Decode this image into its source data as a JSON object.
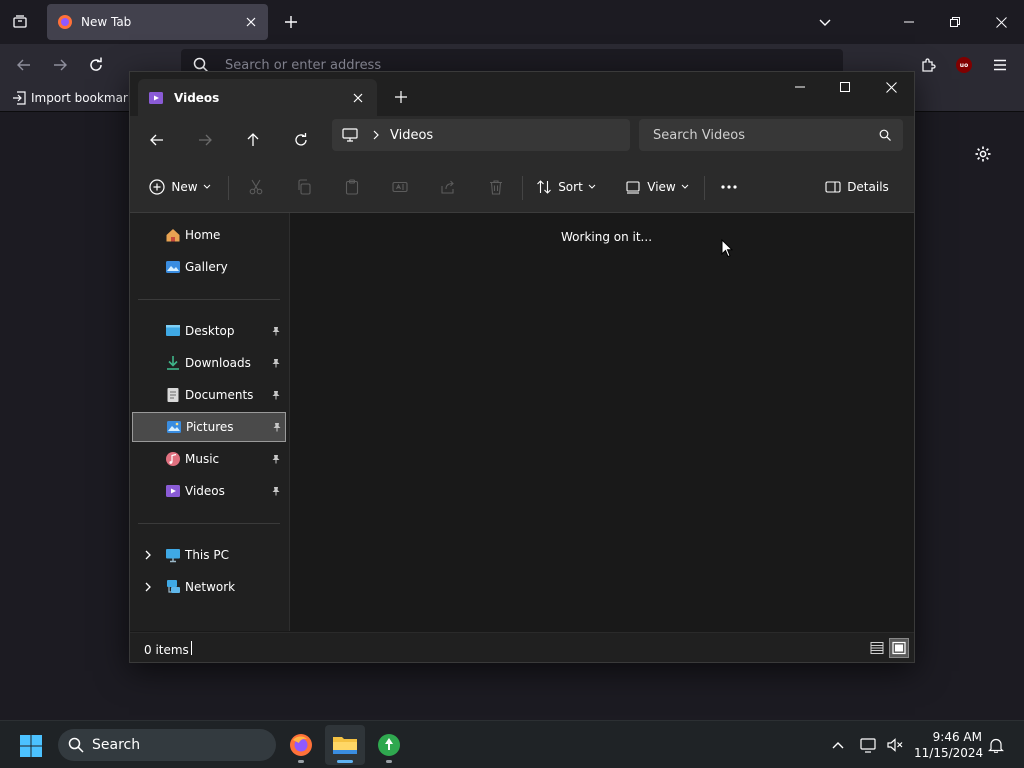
{
  "browser": {
    "tab_title": "New Tab",
    "address_placeholder": "Search or enter address",
    "import_bookmarks_label": "Import bookmarks",
    "extension_badge": "uo"
  },
  "explorer": {
    "tab_title": "Videos",
    "breadcrumb": [
      "Videos"
    ],
    "search_placeholder": "Search Videos",
    "toolbar": {
      "new_label": "New",
      "sort_label": "Sort",
      "view_label": "View",
      "details_label": "Details"
    },
    "nav": {
      "top": [
        {
          "label": "Home",
          "icon": "home-icon"
        },
        {
          "label": "Gallery",
          "icon": "gallery-icon"
        }
      ],
      "quick_access": [
        {
          "label": "Desktop",
          "icon": "desktop-icon",
          "pinned": true
        },
        {
          "label": "Downloads",
          "icon": "downloads-icon",
          "pinned": true
        },
        {
          "label": "Documents",
          "icon": "documents-icon",
          "pinned": true
        },
        {
          "label": "Pictures",
          "icon": "pictures-icon",
          "pinned": true,
          "selected": true
        },
        {
          "label": "Music",
          "icon": "music-icon",
          "pinned": true
        },
        {
          "label": "Videos",
          "icon": "videos-icon",
          "pinned": true
        }
      ],
      "locations": [
        {
          "label": "This PC",
          "icon": "this-pc-icon"
        },
        {
          "label": "Network",
          "icon": "network-icon"
        }
      ]
    },
    "content_status": "Working on it...",
    "status_bar": {
      "items_text": "0 items"
    }
  },
  "taskbar": {
    "search_label": "Search",
    "time": "9:46 AM",
    "date": "11/15/2024"
  },
  "colors": {
    "browser_bg": "#1c1b22",
    "explorer_bg": "#191919",
    "selection": "#4a4a4a",
    "taskbar_active_indicator": "#5fb2f2"
  }
}
